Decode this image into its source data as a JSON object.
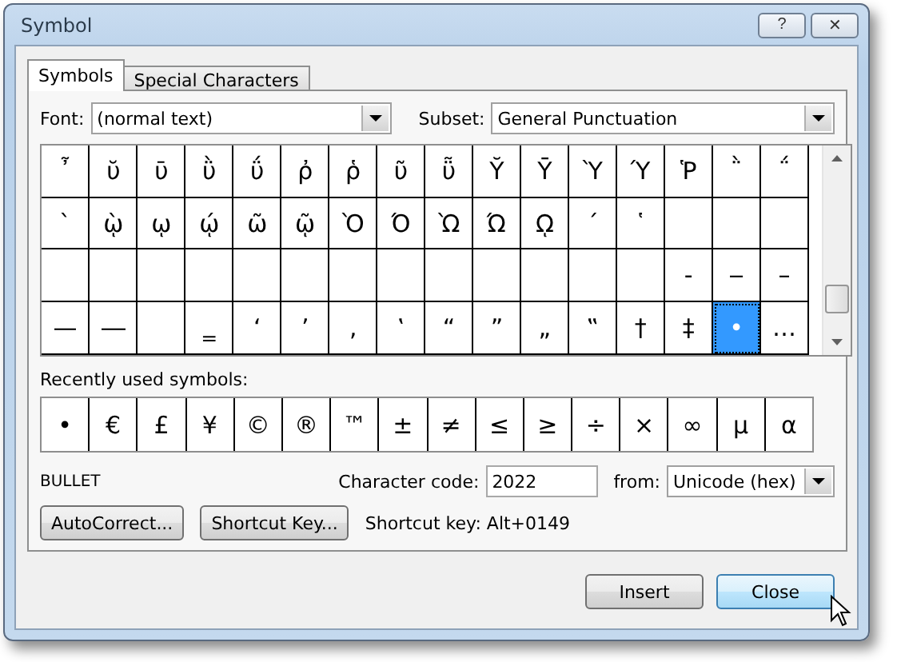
{
  "window": {
    "title": "Symbol",
    "buttons": [
      "?",
      "✕"
    ]
  },
  "tabs": [
    {
      "label": "Symbols",
      "selected": true
    },
    {
      "label": "Special Characters",
      "selected": false
    }
  ],
  "font": {
    "label": "Font:",
    "value": "(normal text)"
  },
  "subset": {
    "label": "Subset:",
    "value": "General Punctuation"
  },
  "grid": {
    "rows": [
      [
        {
          "char": "῏",
          "selected": false
        },
        {
          "char": "ῠ",
          "selected": false
        },
        {
          "char": "ῡ",
          "selected": false
        },
        {
          "char": "ῢ",
          "selected": false
        },
        {
          "char": "ΰ",
          "selected": false
        },
        {
          "char": "ῤ",
          "selected": false
        },
        {
          "char": "ῥ",
          "selected": false
        },
        {
          "char": "ῦ",
          "selected": false
        },
        {
          "char": "ῧ",
          "selected": false
        },
        {
          "char": "Ῠ",
          "selected": false
        },
        {
          "char": "Ῡ",
          "selected": false
        },
        {
          "char": "Ὺ",
          "selected": false
        },
        {
          "char": "Ύ",
          "selected": false
        },
        {
          "char": "Ῥ",
          "selected": false
        },
        {
          "char": "῭",
          "selected": false
        },
        {
          "char": "΅",
          "selected": false
        }
      ],
      [
        {
          "char": "`",
          "selected": false
        },
        {
          "char": "ῲ",
          "selected": false
        },
        {
          "char": "ῳ",
          "selected": false
        },
        {
          "char": "ῴ",
          "selected": false
        },
        {
          "char": "ῶ",
          "selected": false
        },
        {
          "char": "ῷ",
          "selected": false
        },
        {
          "char": "Ὸ",
          "selected": false
        },
        {
          "char": "Ό",
          "selected": false
        },
        {
          "char": "Ὼ",
          "selected": false
        },
        {
          "char": "Ώ",
          "selected": false
        },
        {
          "char": "ῼ",
          "selected": false
        },
        {
          "char": "´",
          "selected": false
        },
        {
          "char": "῾",
          "selected": false
        },
        {
          "selected": false
        },
        {
          "selected": false
        },
        {
          "selected": false
        }
      ],
      [
        {
          "selected": false
        },
        {
          "selected": false
        },
        {
          "selected": false
        },
        {
          "selected": false
        },
        {
          "selected": false
        },
        {
          "selected": false
        },
        {
          "selected": false
        },
        {
          "selected": false
        },
        {
          "selected": false
        },
        {
          "selected": false
        },
        {
          "selected": false
        },
        {
          "selected": false
        },
        {
          "selected": false
        },
        {
          "char": "‐",
          "selected": false
        },
        {
          "char": "‒",
          "selected": false
        },
        {
          "char": "–",
          "selected": false
        }
      ],
      [
        {
          "char": "—",
          "selected": false
        },
        {
          "char": "―",
          "selected": false
        },
        {
          "selected": false
        },
        {
          "char": "‗",
          "selected": false
        },
        {
          "char": "‘",
          "selected": false
        },
        {
          "char": "’",
          "selected": false
        },
        {
          "char": "‚",
          "selected": false
        },
        {
          "char": "‛",
          "selected": false
        },
        {
          "char": "“",
          "selected": false
        },
        {
          "char": "”",
          "selected": false
        },
        {
          "char": "„",
          "selected": false
        },
        {
          "char": "‟",
          "selected": false
        },
        {
          "char": "†",
          "selected": false
        },
        {
          "char": "‡",
          "selected": false
        },
        {
          "char": "•",
          "selected": true
        },
        {
          "char": "…",
          "selected": false
        }
      ]
    ]
  },
  "recent": {
    "label": "Recently used symbols:",
    "symbols": [
      "•",
      "€",
      "£",
      "¥",
      "©",
      "®",
      "™",
      "±",
      "≠",
      "≤",
      "≥",
      "÷",
      "×",
      "∞",
      "µ",
      "α"
    ]
  },
  "char_name": "BULLET",
  "char_code": {
    "label": "Character code:",
    "value": "2022"
  },
  "from": {
    "label": "from:",
    "value": "Unicode (hex)"
  },
  "autocorrect_button": "AutoCorrect...",
  "shortcut_button": "Shortcut Key...",
  "shortcut_text": "Shortcut key: Alt+0149",
  "footer_buttons": [
    {
      "label": "Insert",
      "kind": "normal"
    },
    {
      "label": "Close",
      "kind": "hover"
    }
  ]
}
